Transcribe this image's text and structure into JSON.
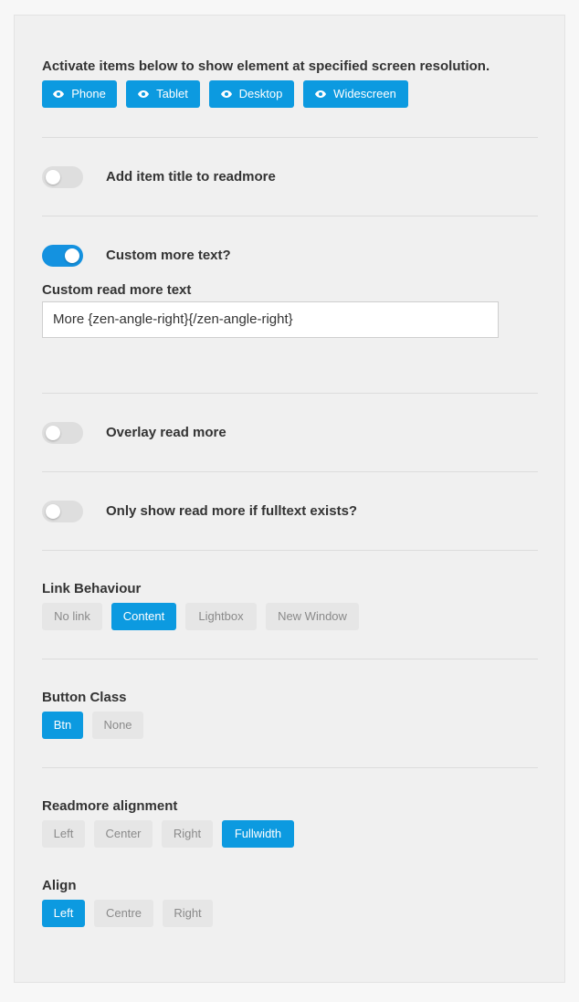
{
  "colors": {
    "accent": "#0c9ae0",
    "toggle_on": "#1492e0",
    "inactive_bg": "#e6e6e6",
    "inactive_text": "#8a8a8a"
  },
  "visibility": {
    "label": "Activate items below to show element at specified screen resolution.",
    "buttons": [
      {
        "label": "Phone",
        "icon": "eye-icon",
        "active": true
      },
      {
        "label": "Tablet",
        "icon": "eye-icon",
        "active": true
      },
      {
        "label": "Desktop",
        "icon": "eye-icon",
        "active": true
      },
      {
        "label": "Widescreen",
        "icon": "eye-icon",
        "active": true
      }
    ]
  },
  "toggles": {
    "add_title": {
      "label": "Add item title to readmore",
      "on": false
    },
    "custom_more": {
      "label": "Custom more text?",
      "on": true
    },
    "overlay": {
      "label": "Overlay read more",
      "on": false
    },
    "only_fulltext": {
      "label": "Only show read more if fulltext exists?",
      "on": false
    }
  },
  "custom_text": {
    "label": "Custom read more text",
    "value": "More {zen-angle-right}{/zen-angle-right}"
  },
  "link_behaviour": {
    "label": "Link Behaviour",
    "options": [
      "No link",
      "Content",
      "Lightbox",
      "New Window"
    ],
    "selected": "Content"
  },
  "button_class": {
    "label": "Button Class",
    "options": [
      "Btn",
      "None"
    ],
    "selected": "Btn"
  },
  "readmore_alignment": {
    "label": "Readmore alignment",
    "options": [
      "Left",
      "Center",
      "Right",
      "Fullwidth"
    ],
    "selected": "Fullwidth"
  },
  "align": {
    "label": "Align",
    "options": [
      "Left",
      "Centre",
      "Right"
    ],
    "selected": "Left"
  }
}
